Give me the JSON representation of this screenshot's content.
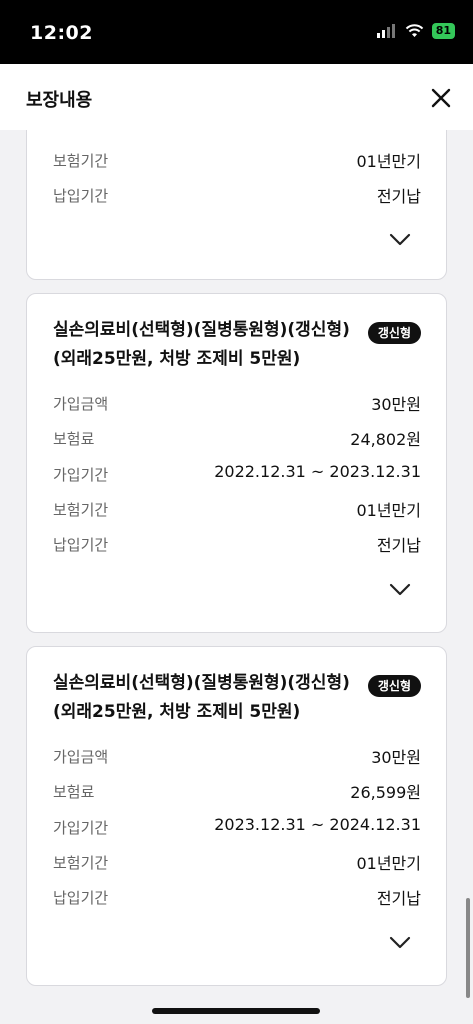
{
  "status_bar": {
    "time": "12:02",
    "battery": "81"
  },
  "header": {
    "title": "보장내용"
  },
  "cards": [
    {
      "rows": [
        {
          "label": "보험기간",
          "value": "01년만기"
        },
        {
          "label": "납입기간",
          "value": "전기납"
        }
      ]
    },
    {
      "title": "실손의료비(선택형)(질병통원형)(갱신형)(외래25만원, 처방 조제비 5만원)",
      "badge": "갱신형",
      "rows": [
        {
          "label": "가입금액",
          "value": "30만원"
        },
        {
          "label": "보험료",
          "value": "24,802원"
        },
        {
          "label": "가입기간",
          "value": "2022.12.31 ~ 2023.12.31"
        },
        {
          "label": "보험기간",
          "value": "01년만기"
        },
        {
          "label": "납입기간",
          "value": "전기납"
        }
      ]
    },
    {
      "title": "실손의료비(선택형)(질병통원형)(갱신형)(외래25만원, 처방 조제비 5만원)",
      "badge": "갱신형",
      "rows": [
        {
          "label": "가입금액",
          "value": "30만원"
        },
        {
          "label": "보험료",
          "value": "26,599원"
        },
        {
          "label": "가입기간",
          "value": "2023.12.31 ~ 2024.12.31"
        },
        {
          "label": "보험기간",
          "value": "01년만기"
        },
        {
          "label": "납입기간",
          "value": "전기납"
        }
      ]
    }
  ]
}
